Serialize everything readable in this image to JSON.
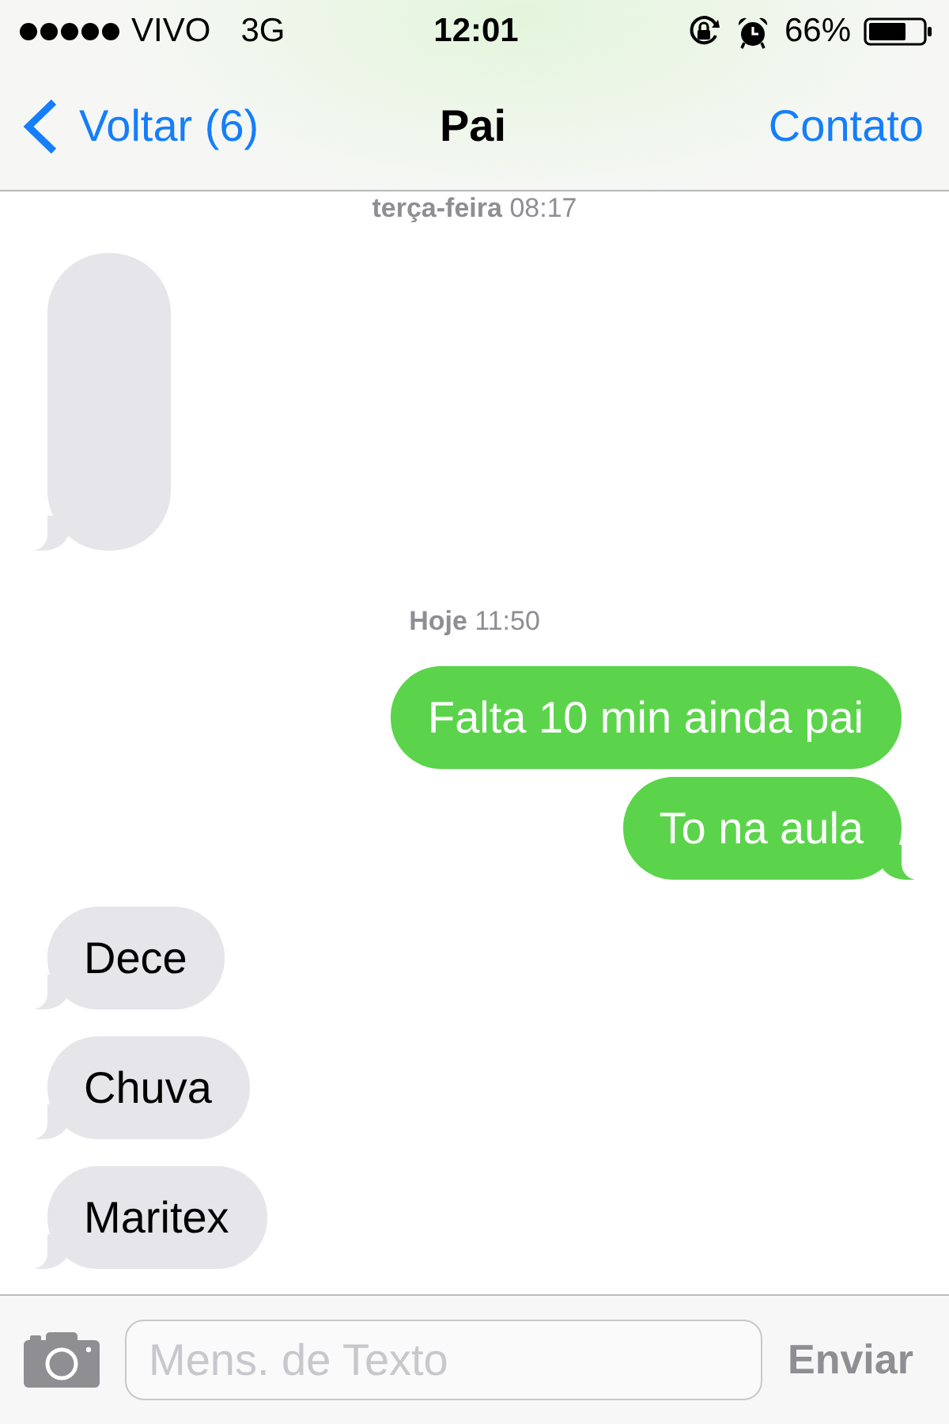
{
  "status_bar": {
    "carrier": "VIVO",
    "network": "3G",
    "time": "12:01",
    "battery": "66%"
  },
  "nav_bar": {
    "back": "Voltar (6)",
    "title": "Pai",
    "action": "Contato"
  },
  "messages": [
    {
      "kind": "timestamp",
      "text": "**terça-feira** 08:17"
    },
    {
      "kind": "blank",
      "sent": false,
      "tail": true
    },
    {
      "kind": "timestamp",
      "text": "**Hoje** 11:50"
    },
    {
      "kind": "text",
      "sent": true,
      "tail": false,
      "text": "Falta 10 min ainda pai"
    },
    {
      "kind": "text",
      "sent": true,
      "tail": true,
      "text": "To na aula"
    },
    {
      "kind": "text",
      "sent": false,
      "tail": true,
      "text": "Dece"
    },
    {
      "kind": "text",
      "sent": false,
      "tail": true,
      "text": "Chuva"
    },
    {
      "kind": "text",
      "sent": false,
      "tail": true,
      "text": "Maritex"
    }
  ],
  "composer": {
    "placeholder": "Mens. de Texto",
    "send": {
      "label": "Enviar",
      "disabled": true
    }
  }
}
